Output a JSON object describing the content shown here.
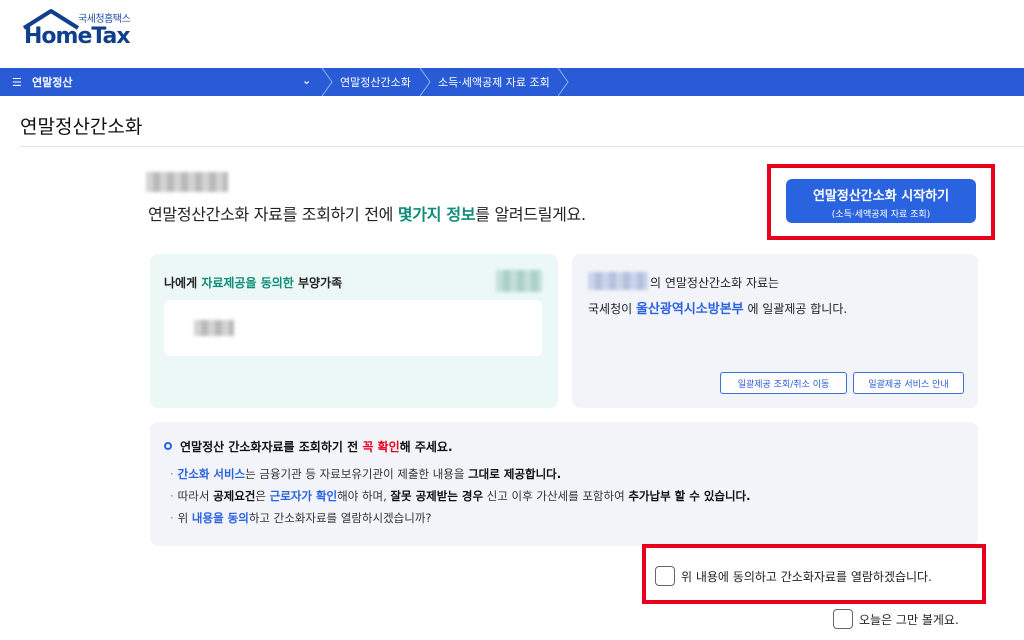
{
  "logo": {
    "sub": "국세청홈택스",
    "main": "HomeTax"
  },
  "nav": {
    "menu_label": "연말정산",
    "breadcrumbs": [
      "연말정산간소화",
      "소득·세액공제 자료 조회"
    ]
  },
  "page": {
    "title": "연말정산간소화"
  },
  "intro": {
    "before": "연말정산간소화 자료를 조회하기 전에 ",
    "highlight": "몇가지 정보",
    "after": "를 알려드릴게요."
  },
  "start_button": {
    "line1": "연말정산간소화 시작하기",
    "line2": "(소득·세액공제 자료 조회)"
  },
  "consent_card": {
    "prefix": "나에게 ",
    "highlight": "자료제공을 동의한",
    "suffix": " 부양가족"
  },
  "provider_card": {
    "line1": "의 연말정산간소화 자료는",
    "line2_prefix": "국세청이 ",
    "line2_highlight": "울산광역시소방본부",
    "line2_suffix": " 에 일괄제공 합니다.",
    "btn_query": "일괄제공 조회/취소 이동",
    "btn_guide": "일괄제공 서비스 안내"
  },
  "notice": {
    "head_pre": "연말정산 간소화자료를 조회하기 전 ",
    "head_red": "꼭 확인",
    "head_post": "해 주세요.",
    "l1_blue": "간소화 서비스",
    "l1_mid": "는 금융기관 등 자료보유기관이 제출한 내용을 ",
    "l1_bold": "그대로 제공합니다.",
    "l2_pre": "따라서 ",
    "l2_b1": "공제요건",
    "l2_mid1": "은 ",
    "l2_blue": "근로자가 확인",
    "l2_mid2": "해야 하며, ",
    "l2_b2": "잘못 공제받는 경우",
    "l2_mid3": " 신고 이후 가산세를 포함하여 ",
    "l2_b3": "추가납부 할 수 있습니다.",
    "l3_pre": "위 ",
    "l3_blue": "내용을 동의",
    "l3_post": "하고 간소화자료를 열람하시겠습니까?"
  },
  "checks": {
    "agree": "위 내용에 동의하고 간소화자료를 열람하겠습니다.",
    "today": "오늘은 그만 볼게요."
  }
}
